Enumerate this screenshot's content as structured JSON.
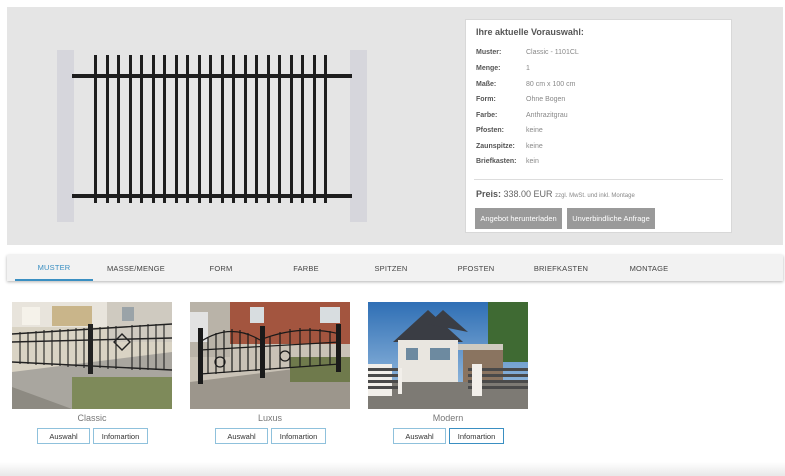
{
  "summary": {
    "title": "Ihre aktuelle Vorauswahl:",
    "rows": [
      {
        "key": "Muster:",
        "value": "Classic - 1101CL"
      },
      {
        "key": "Menge:",
        "value": "1"
      },
      {
        "key": "Maße:",
        "value": "80 cm x 100 cm"
      },
      {
        "key": "Form:",
        "value": "Ohne Bogen"
      },
      {
        "key": "Farbe:",
        "value": "Anthrazitgrau"
      },
      {
        "key": "Pfosten:",
        "value": "keine"
      },
      {
        "key": "Zaunspitze:",
        "value": "keine"
      },
      {
        "key": "Briefkasten:",
        "value": "kein"
      }
    ],
    "price_label": "Preis:",
    "price_value": "338.00 EUR",
    "price_note": "zzgl. MwSt. und inkl. Montage",
    "download_button": "Angebot herunterladen",
    "request_button": "Unverbindliche Anfrage"
  },
  "tabs": [
    "MUSTER",
    "MASSE/MENGE",
    "FORM",
    "FARBE",
    "SPITZEN",
    "PFOSTEN",
    "BRIEFKASTEN",
    "MONTAGE"
  ],
  "active_tab": "MUSTER",
  "cards": [
    {
      "name": "Classic",
      "select": "Auswahl",
      "info": "Infomartion"
    },
    {
      "name": "Luxus",
      "select": "Auswahl",
      "info": "Infomartion"
    },
    {
      "name": "Modern",
      "select": "Auswahl",
      "info": "Infomartion"
    }
  ],
  "colors": {
    "accent": "#3a8fc2",
    "fence": "#1e1e1e",
    "button_grey": "#9a9a9a"
  }
}
